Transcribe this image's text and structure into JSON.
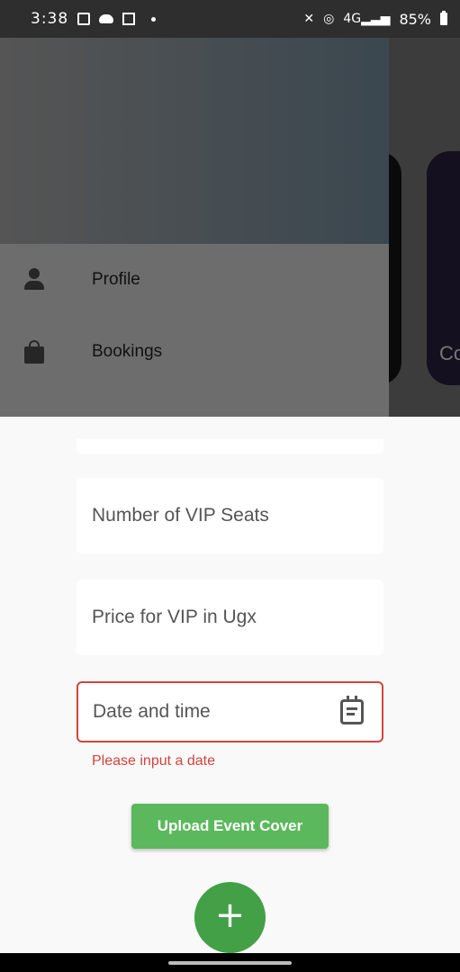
{
  "status_bar": {
    "time": "3:38",
    "battery": "85%",
    "network": "4G"
  },
  "drawer": {
    "items": [
      {
        "label": "Profile",
        "icon": "person-icon"
      },
      {
        "label": "Bookings",
        "icon": "shopping-bag-icon"
      }
    ]
  },
  "background": {
    "card_text": "Co"
  },
  "form": {
    "vip_seats_placeholder": "Number of VIP Seats",
    "vip_price_placeholder": "Price for VIP in Ugx",
    "date_placeholder": "Date and time",
    "date_error": "Please input a date",
    "upload_label": "Upload Event Cover",
    "fab_label": "+"
  },
  "colors": {
    "accent_green": "#5cb85c",
    "error_red": "#d0453d"
  }
}
